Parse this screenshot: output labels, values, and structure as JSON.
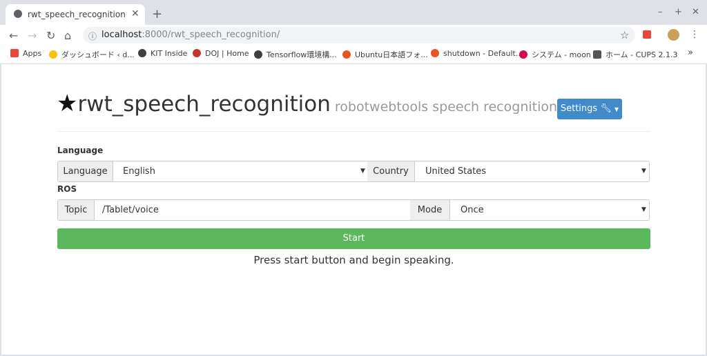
{
  "browser": {
    "tab_title": "rwt_speech_recognition",
    "tab_close": "✕",
    "new_tab": "+",
    "window_controls": [
      "–",
      "+",
      "✕"
    ],
    "url_host": "localhost",
    "url_path": ":8000/rwt_speech_recognition/",
    "bookmarks": [
      {
        "label": "Apps",
        "icon": "apps-grid-icon",
        "color": "#e8453c"
      },
      {
        "label": "ダッシュボード ‹ d...",
        "icon": "wordpress-icon",
        "color": "#f2c40f"
      },
      {
        "label": "KIT Inside",
        "icon": "globe-icon",
        "color": "#3c4043"
      },
      {
        "label": "DOJ | Home",
        "icon": "doj-icon",
        "color": "#c0392b"
      },
      {
        "label": "Tensorflow環境構...",
        "icon": "info-icon",
        "color": "#3c4043"
      },
      {
        "label": "Ubuntu日本語フォ...",
        "icon": "ubuntu-icon",
        "color": "#e95420"
      },
      {
        "label": "shutdown - Default...",
        "icon": "askubuntu-icon",
        "color": "#e95420"
      },
      {
        "label": "システム - moon",
        "icon": "debian-icon",
        "color": "#d70751"
      },
      {
        "label": "ホーム - CUPS 2.1.3",
        "icon": "cups-icon",
        "color": "#555555"
      }
    ],
    "bookmarks_overflow": "»"
  },
  "header": {
    "star": "★",
    "title": "rwt_speech_recognition",
    "subtitle": "robotwebtools speech recognition",
    "settings_label": "Settings"
  },
  "language_section": {
    "heading": "Language",
    "language_addon": "Language",
    "language_value": "English",
    "country_addon": "Country",
    "country_value": "United States"
  },
  "ros_section": {
    "heading": "ROS",
    "topic_addon": "Topic",
    "topic_value": "/Tablet/voice",
    "mode_addon": "Mode",
    "mode_value": "Once"
  },
  "start_label": "Start",
  "status_text": "Press start button and begin speaking.",
  "colors": {
    "primary": "#428bca",
    "success": "#5cb85c"
  }
}
